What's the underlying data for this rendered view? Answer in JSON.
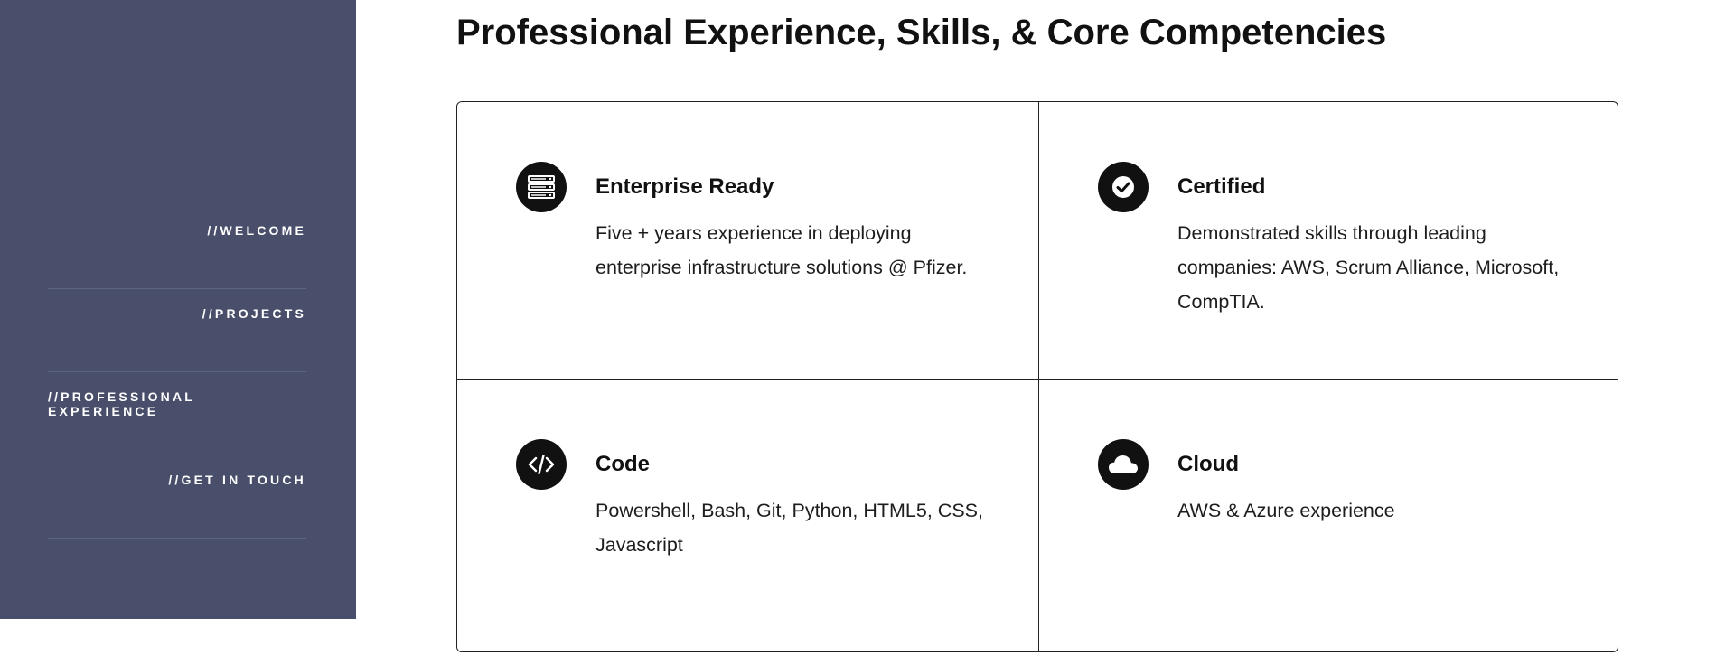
{
  "sidebar": {
    "background": "#494f6b",
    "items": [
      {
        "label": "//WELCOME"
      },
      {
        "label": "//PROJECTS"
      },
      {
        "label": "//PROFESSIONAL EXPERIENCE"
      },
      {
        "label": "//GET IN TOUCH"
      }
    ]
  },
  "main": {
    "title": "Professional Experience, Skills, & Core Competencies",
    "cards": [
      {
        "icon": "server-icon",
        "title": "Enterprise Ready",
        "description": "Five + years experience in deploying enterprise infrastructure solutions @ Pfizer."
      },
      {
        "icon": "check-circle-icon",
        "title": "Certified",
        "description": "Demonstrated skills through leading companies: AWS, Scrum Alliance, Microsoft, CompTIA."
      },
      {
        "icon": "code-icon",
        "title": "Code",
        "description": "Powershell, Bash, Git, Python, HTML5, CSS, Javascript"
      },
      {
        "icon": "cloud-icon",
        "title": "Cloud",
        "description": "AWS & Azure experience"
      }
    ]
  }
}
